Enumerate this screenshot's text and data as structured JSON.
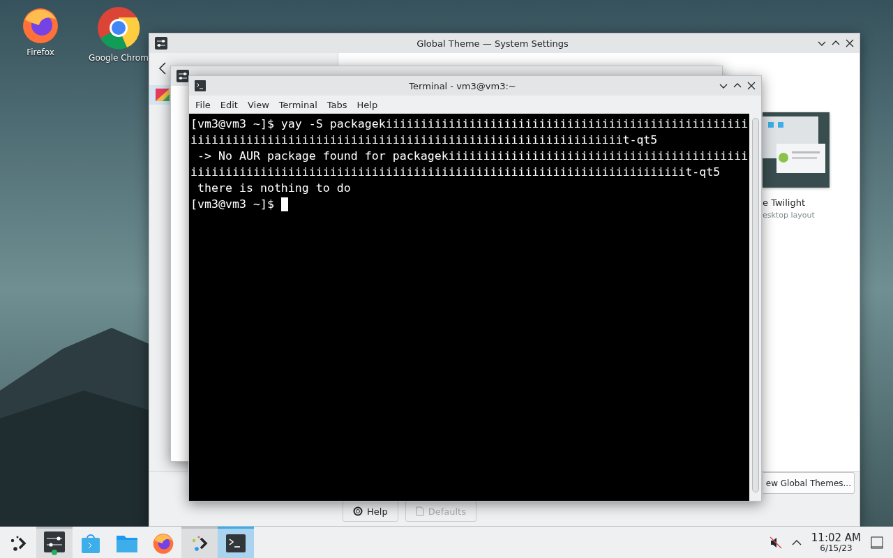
{
  "desktop_icons": [
    {
      "kind": "firefox",
      "label": "Firefox"
    },
    {
      "kind": "chrome",
      "label": "Google Chrom"
    }
  ],
  "settings_window": {
    "title": "Global Theme — System Settings",
    "theme_card": {
      "name": "e Twilight",
      "description": "esktop layout"
    },
    "get_new_button": "ew Global Themes...",
    "footer_buttons": [
      {
        "label": "Help",
        "disabled": false
      },
      {
        "label": "Defaults",
        "disabled": true
      }
    ]
  },
  "terminal": {
    "title": "Terminal - vm3@vm3:~",
    "menu": [
      "File",
      "Edit",
      "View",
      "Terminal",
      "Tabs",
      "Help"
    ],
    "lines": [
      "[vm3@vm3 ~]$ yay -S packagekiiiiiiiiiiiiiiiiiiiiiiiiiiiiiiiiiiiiiiiiiiiiiiiiiiii",
      "iiiiiiiiiiiiiiiiiiiiiiiiiiiiiiiiiiiiiiiiiiiiiiiiiiiiiiiiiiiiiit-qt5",
      " -> No AUR package found for packagekiiiiiiiiiiiiiiiiiiiiiiiiiiiiiiiiiiiiiiiiiii",
      "iiiiiiiiiiiiiiiiiiiiiiiiiiiiiiiiiiiiiiiiiiiiiiiiiiiiiiiiiiiiiiiiiiiiiiit-qt5",
      " there is nothing to do",
      "[vm3@vm3 ~]$ "
    ]
  },
  "taskbar": {
    "tasks": [
      {
        "kind": "launcher",
        "open": false,
        "selected": false
      },
      {
        "kind": "settings",
        "open": true,
        "selected": false
      },
      {
        "kind": "store",
        "open": false,
        "selected": false
      },
      {
        "kind": "folder",
        "open": false,
        "selected": false
      },
      {
        "kind": "firefox",
        "open": false,
        "selected": false
      },
      {
        "kind": "dots",
        "open": true,
        "selected": false
      },
      {
        "kind": "terminal",
        "open": true,
        "selected": true
      }
    ],
    "clock": {
      "time": "11:02 AM",
      "date": "6/15/23"
    }
  }
}
